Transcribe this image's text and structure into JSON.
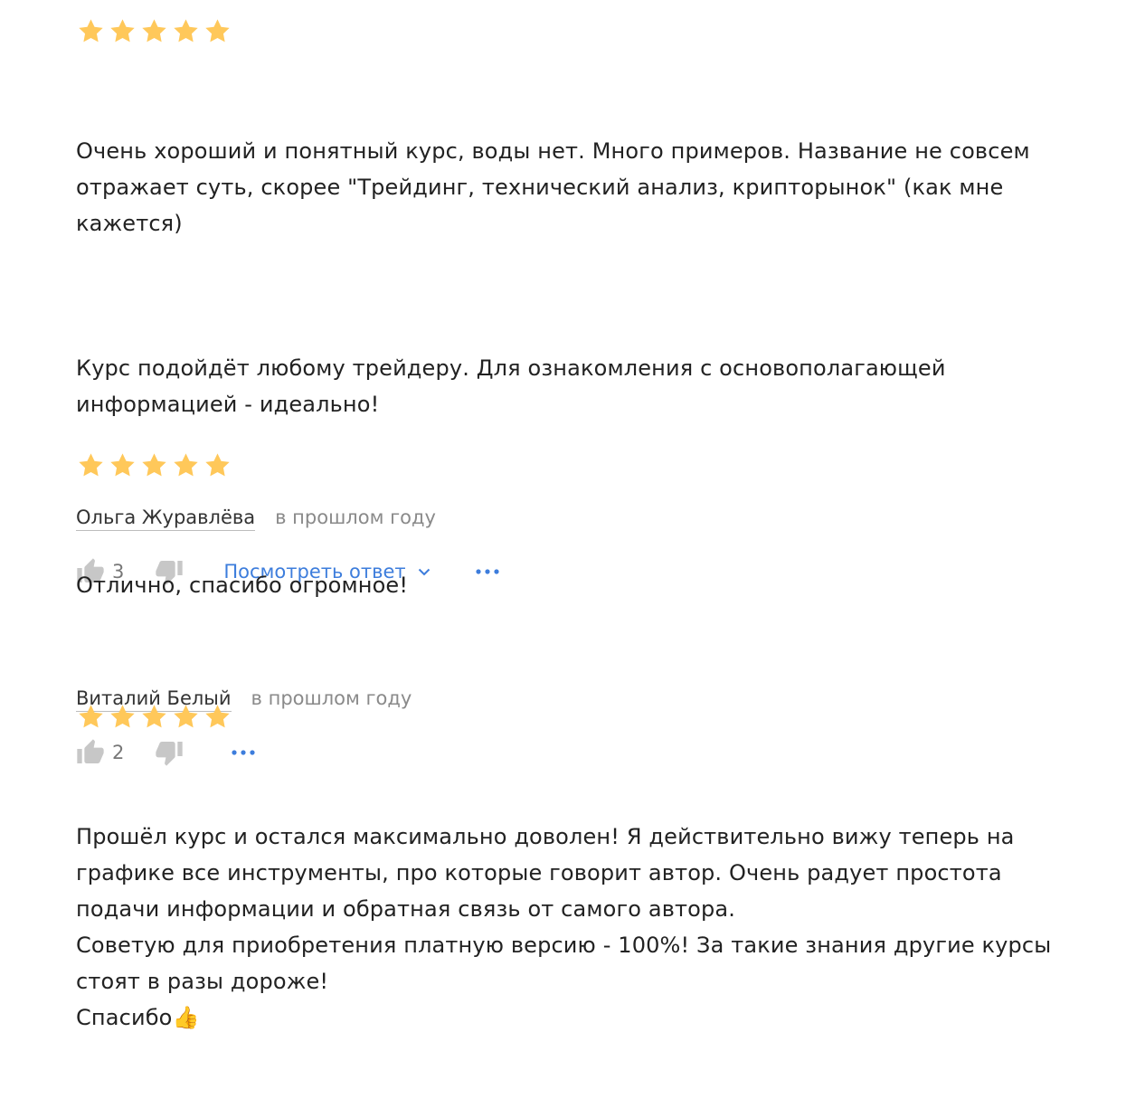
{
  "colors": {
    "star": "#FFC85A",
    "link": "#3D7DDC",
    "icon_gray": "#C7C7C7"
  },
  "reviews": [
    {
      "rating": 5,
      "paragraphs": [
        "Очень хороший и понятный курс, воды нет. Много примеров. Название не совсем\nотражает суть, скорее \"Трейдинг, технический анализ, крипторынок\" (как мне\nкажется)",
        "Курс подойдёт любому трейдеру. Для ознакомления с основополагающей\nинформацией - идеально!"
      ],
      "author": "Ольга Журавлёва",
      "date": "в прошлом году",
      "likes": "3",
      "reply_label": "Посмотреть ответ"
    },
    {
      "rating": 5,
      "paragraphs": [
        "Отлично, спасибо огромное!"
      ],
      "author": "Виталий Белый",
      "date": "в прошлом году",
      "likes": "2"
    },
    {
      "rating": 5,
      "paragraphs": [
        "Прошёл курс и остался максимально доволен! Я действительно вижу теперь на\nграфике все инструменты, про которые говорит автор. Очень радует простота\nподачи информации и обратная связь от самого автора.\nСоветую для приобретения платную версию - 100%! За такие знания другие курсы\nстоят в разы дороже!\nСпасибо👍"
      ]
    }
  ]
}
